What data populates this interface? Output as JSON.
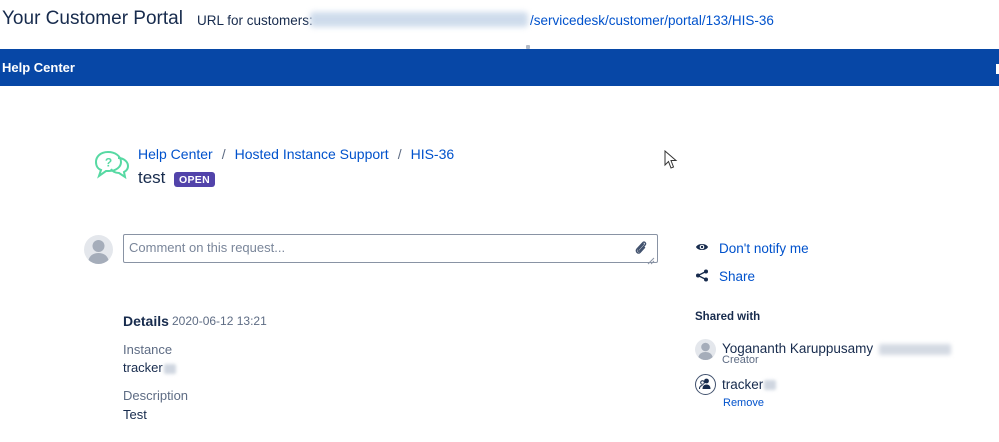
{
  "portal": {
    "title": "Your Customer Portal",
    "url_label": "URL for customers:",
    "url_path": "/servicedesk/customer/portal/133/HIS-36"
  },
  "navbar": {
    "help_center": "Help Center"
  },
  "breadcrumb": [
    "Help Center",
    "Hosted Instance Support",
    "HIS-36"
  ],
  "request": {
    "title": "test",
    "status": "OPEN"
  },
  "comment": {
    "placeholder": "Comment on this request..."
  },
  "sidebar": {
    "dont_notify": "Don't notify me",
    "share": "Share",
    "shared_with_heading": "Shared with",
    "participants": [
      {
        "name": "Yogananth Karuppusamy",
        "role": "Creator"
      },
      {
        "name": "tracker",
        "action": "Remove"
      }
    ]
  },
  "details": {
    "heading": "Details",
    "date": "2020-06-12 13:21",
    "fields": [
      {
        "label": "Instance",
        "value": "tracker"
      },
      {
        "label": "Description",
        "value": "Test"
      }
    ]
  },
  "colors": {
    "nav_bar": "#0747a6",
    "link": "#0052cc",
    "status_open": "#5243aa",
    "icon_green": "#57d9a3"
  },
  "icons": [
    "question-bubble-icon",
    "attachment-icon",
    "eye-icon",
    "share-icon",
    "avatar-icon",
    "organization-icon",
    "mouse-cursor-icon"
  ]
}
